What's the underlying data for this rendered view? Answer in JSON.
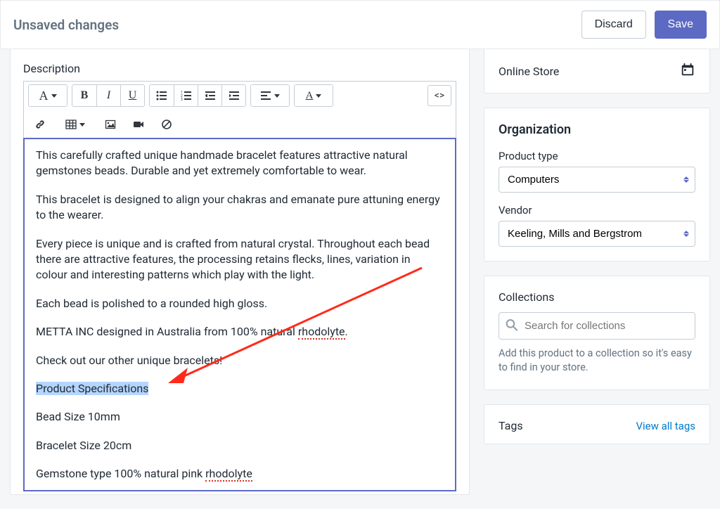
{
  "header": {
    "title": "Unsaved changes",
    "discard": "Discard",
    "save": "Save"
  },
  "description_label": "Description",
  "html_btn": "<>",
  "editor": {
    "p1": "This carefully crafted unique handmade bracelet features attractive natural gemstones beads.  Durable and yet extremely comfortable to wear.",
    "p2": "This bracelet is designed to align your chakras and emanate pure attuning energy to the wearer.",
    "p3a": "Every piece is unique and is crafted from natural crystal.  Throughout each bead there are attractive features, the processing retains flecks, lines, variation in ",
    "p3b": "colour",
    "p3c": " and interesting patterns which play with the light.",
    "p4": "Each bead is polished to a rounded high gloss.",
    "p5a": "METTA INC designed in Australia from 100% natural ",
    "p5b": "rhodolyte",
    "p5c": ".",
    "p6": "Check out our other unique bracelets!",
    "p7": "Product Specifications",
    "p8": "Bead Size 10mm",
    "p9": "Bracelet Size 20cm",
    "p10a": "Gemstone type 100% natural pink ",
    "p10b": "rhodolyte"
  },
  "online_store": {
    "label": "Online Store"
  },
  "organization": {
    "heading": "Organization",
    "product_type_label": "Product type",
    "product_type_value": "Computers",
    "vendor_label": "Vendor",
    "vendor_value": "Keeling, Mills and Bergstrom"
  },
  "collections": {
    "heading": "Collections",
    "search_placeholder": "Search for collections",
    "help": "Add this product to a collection so it's easy to find in your store."
  },
  "tags": {
    "heading": "Tags",
    "view_all": "View all tags"
  }
}
